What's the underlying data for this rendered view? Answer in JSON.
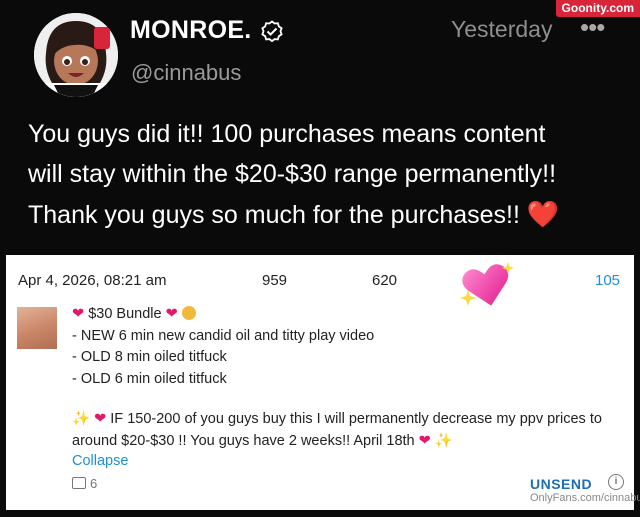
{
  "watermark": "Goonity.com",
  "post": {
    "display_name": "MONROE.",
    "handle": "@cinnabus",
    "timestamp": "Yesterday",
    "more_icon": "more-horizontal-icon",
    "verified_icon": "verified-badge-icon",
    "text_lines": [
      "You guys did it!! 100 purchases means content",
      "will stay within the $20-$30 range permanently!!",
      "Thank you guys so much for the purchases!!"
    ],
    "text_emoji": "❤️"
  },
  "card": {
    "date": "Apr 4, 2026, 08:21 am",
    "stats": [
      "959",
      "620",
      "105"
    ],
    "bundle_title": "$30 Bundle",
    "items": [
      "- NEW 6 min new candid oil and titty play video",
      "- OLD 8 min oiled titfuck",
      "- OLD 6 min oiled titfuck"
    ],
    "paragraph_lines": [
      "IF 150-200 of you guys buy this I will permanently decrease my ppv prices to",
      "around $20-$30 !! You guys have 2 weeks!! April 18th"
    ],
    "collapse_label": "Collapse",
    "media_count": "6",
    "unsend_label": "UNSEND",
    "info_glyph": "i",
    "site_watermark": "OnlyFans.com/cinnabus",
    "colors": {
      "link": "#1f8fd6",
      "heart": "#e2186b"
    }
  }
}
